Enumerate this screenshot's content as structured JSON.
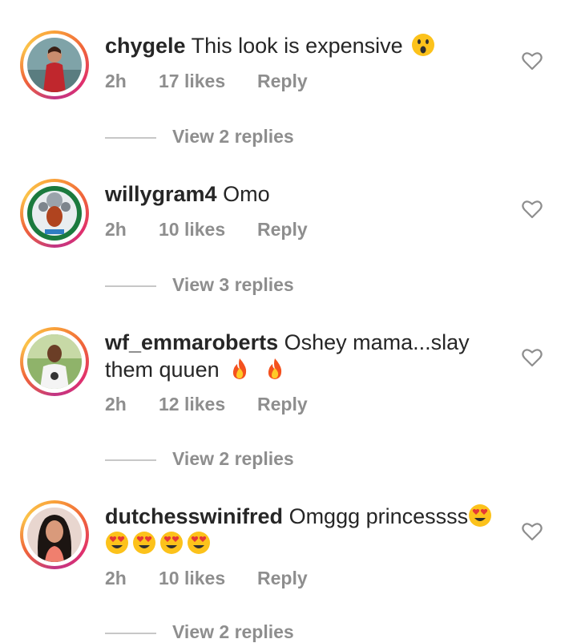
{
  "comments": [
    {
      "username": "chygele",
      "text": "This look is expensive",
      "emojis": [
        "astonished-face"
      ],
      "time": "2h",
      "likes": "17 likes",
      "reply_label": "Reply",
      "view_replies": "View 2 replies"
    },
    {
      "username": "willygram4",
      "text": "Omo",
      "emojis": [],
      "time": "2h",
      "likes": "10 likes",
      "reply_label": "Reply",
      "view_replies": "View 3 replies"
    },
    {
      "username": "wf_emmaroberts",
      "text_line1": "Oshey mama...slay",
      "text_line2": "them quuen",
      "emojis": [
        "fire",
        "fire"
      ],
      "time": "2h",
      "likes": "12 likes",
      "reply_label": "Reply",
      "view_replies": "View 2 replies"
    },
    {
      "username": "dutchesswinifred",
      "text": "Omggg princessss",
      "emojis": [
        "smiling-face-with-heart-eyes",
        "smiling-face-with-heart-eyes",
        "smiling-face-with-heart-eyes",
        "smiling-face-with-heart-eyes",
        "smiling-face-with-heart-eyes"
      ],
      "time": "2h",
      "likes": "10 likes",
      "reply_label": "Reply",
      "view_replies": "View 2 replies"
    }
  ],
  "colors": {
    "text": "#262626",
    "meta": "#8e8e8e",
    "divider": "#c7c7c7",
    "ring_start": "#f9a13a",
    "ring_mid": "#e1306c"
  }
}
